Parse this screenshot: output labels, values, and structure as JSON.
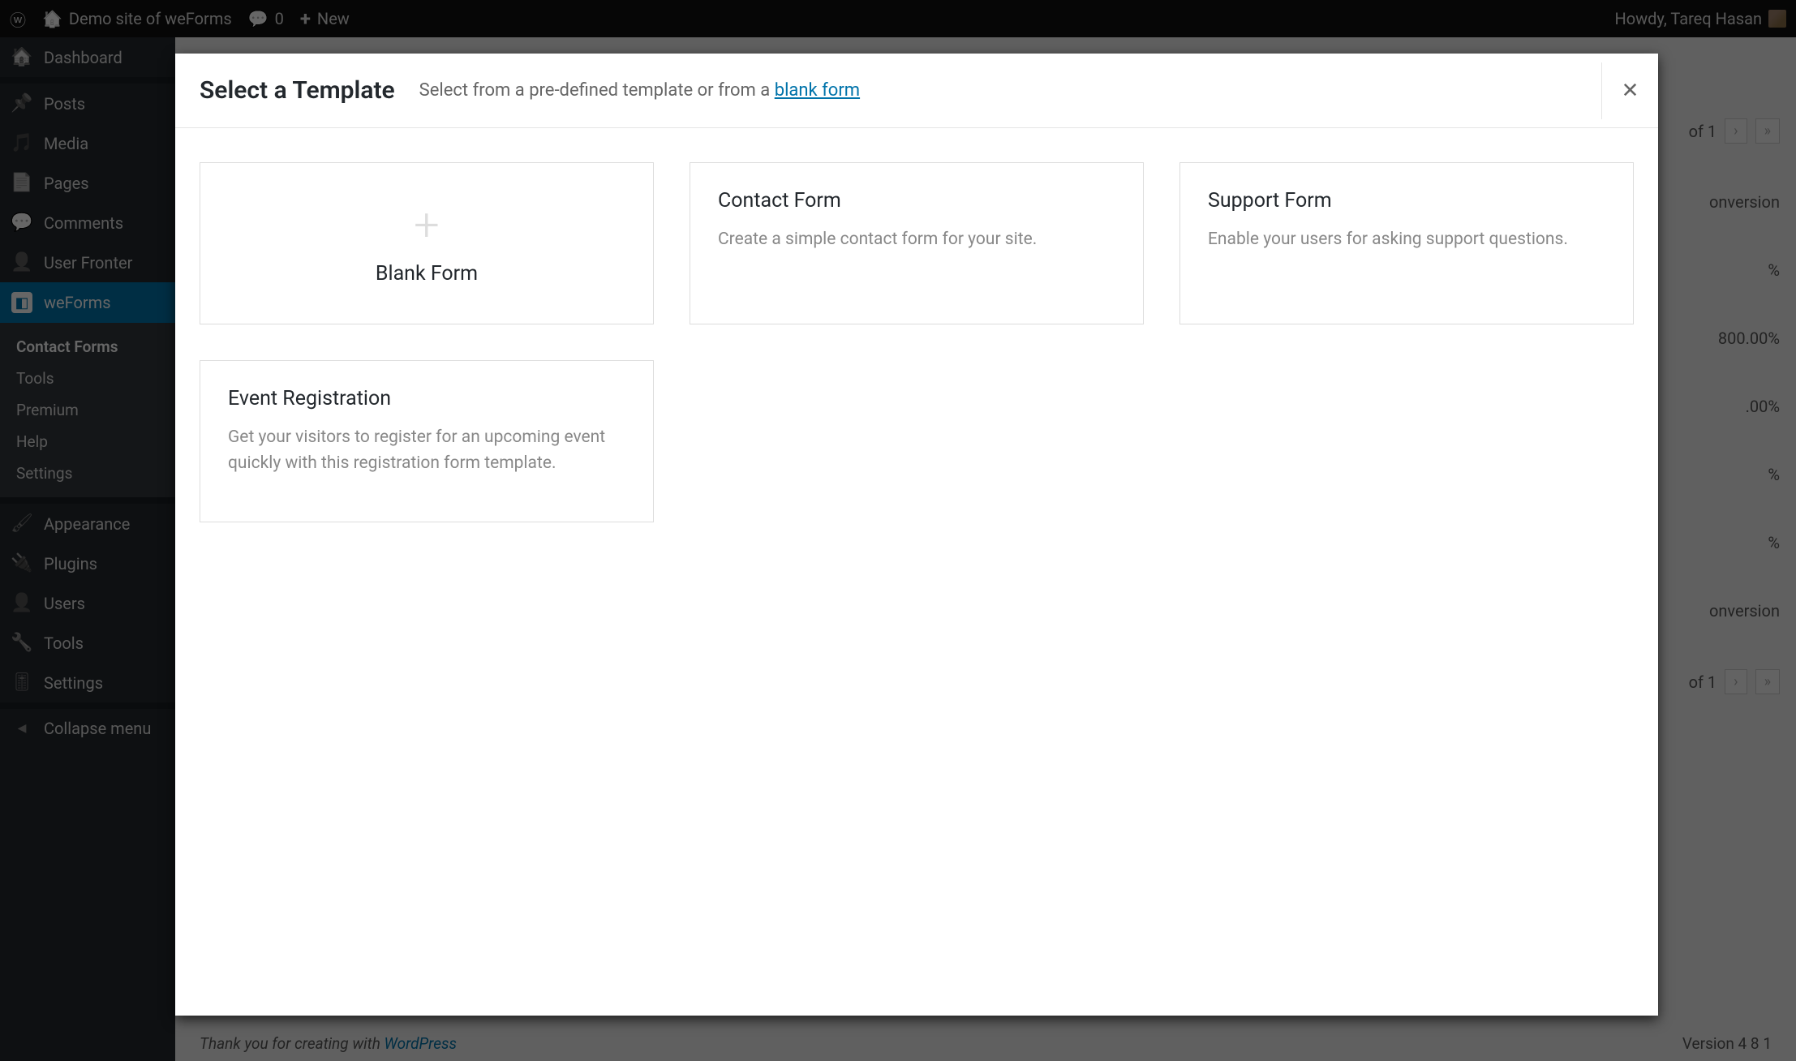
{
  "adminbar": {
    "site_title": "Demo site of weForms",
    "comments_count": "0",
    "new_label": "New",
    "howdy": "Howdy, Tareq Hasan"
  },
  "sidebar": {
    "dashboard": "Dashboard",
    "posts": "Posts",
    "media": "Media",
    "pages": "Pages",
    "comments": "Comments",
    "user_frontend": "User Fronter",
    "weforms": "weForms",
    "sub": {
      "contact_forms": "Contact Forms",
      "tools": "Tools",
      "premium": "Premium",
      "help": "Help",
      "settings": "Settings"
    },
    "appearance": "Appearance",
    "plugins": "Plugins",
    "users": "Users",
    "tools": "Tools",
    "settings": "Settings",
    "collapse": "Collapse menu"
  },
  "modal": {
    "title": "Select a Template",
    "subtitle_prefix": "Select from a pre-defined template or from a ",
    "subtitle_link": "blank form",
    "templates": {
      "blank": {
        "title": "Blank Form"
      },
      "contact": {
        "title": "Contact Form",
        "desc": "Create a simple contact form for your site."
      },
      "support": {
        "title": "Support Form",
        "desc": "Enable your users for asking support questions."
      },
      "event": {
        "title": "Event Registration",
        "desc": "Get your visitors to register for an upcoming event quickly with this registration form template."
      }
    }
  },
  "background": {
    "pagination_text": "of 1",
    "conversion_header_top": "onversion",
    "conversion_header_bottom": "onversion",
    "pct_suffix": "%",
    "row2_pct": "800.00%",
    "row3_pct": ".00%",
    "footer_prefix": "Thank you for creating with ",
    "footer_link": "WordPress",
    "version": "Version 4 8 1"
  }
}
